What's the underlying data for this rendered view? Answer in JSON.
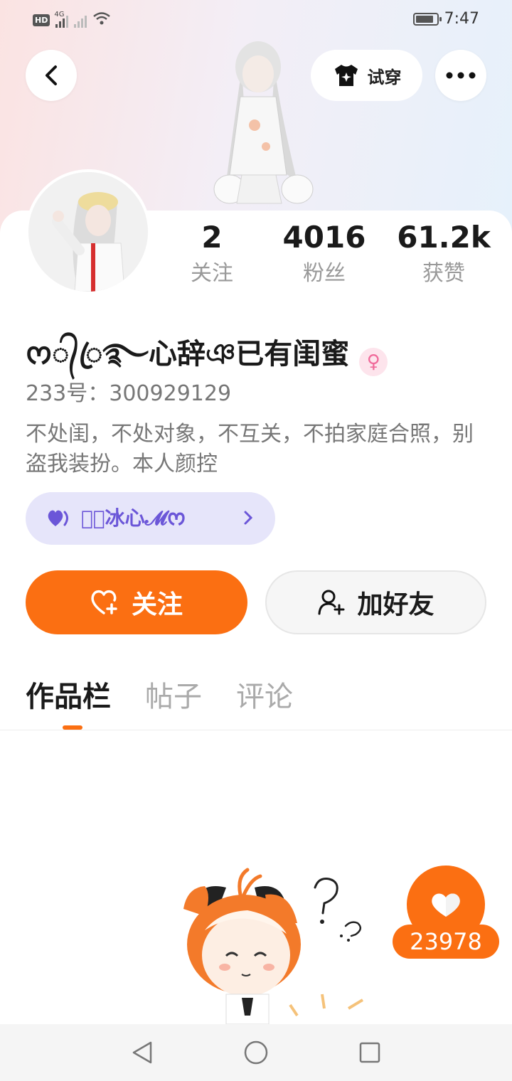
{
  "status_bar": {
    "hd": "HD",
    "network": "4G",
    "time": "7:47",
    "battery_level": 0.75
  },
  "header": {
    "tryon_label": "试穿",
    "back_icon": "chevron-left-icon",
    "more_icon": "more-dots-icon",
    "tryon_icon": "tshirt-star-icon"
  },
  "stats": [
    {
      "value": "2",
      "label": "关注"
    },
    {
      "value": "4016",
      "label": "粉丝"
    },
    {
      "value": "61.2k",
      "label": "获赞"
    }
  ],
  "profile": {
    "username": "ᰔ᭄ꦿ࿐心辞ঞ已有闺蜜",
    "gender_icon": "female-icon",
    "uid": "233号：300929129",
    "bio": "不处闺，不处对象，不互关，不拍家庭合照，别盗我装扮。本人颜控",
    "tag": "𝓜ꦿ冰心𝓜ᰔ"
  },
  "actions": {
    "follow_label": "关注",
    "add_friend_label": "加好友"
  },
  "tabs": [
    {
      "label": "作品栏",
      "active": true
    },
    {
      "label": "帖子",
      "active": false
    },
    {
      "label": "评论",
      "active": false
    }
  ],
  "like_fab": {
    "count": "23978"
  },
  "colors": {
    "accent": "#fb6f12",
    "tag_bg": "#e6e5fa",
    "tag_text": "#6b56d8",
    "female": "#f06a9a"
  }
}
